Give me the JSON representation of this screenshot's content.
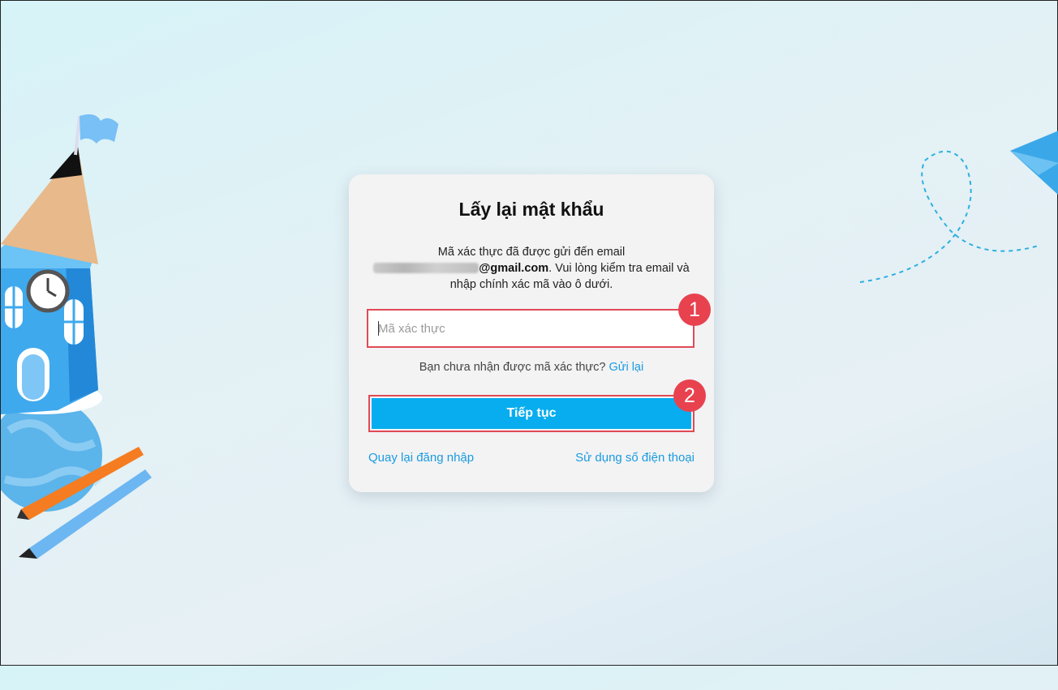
{
  "recovery": {
    "title": "Lấy lại mật khẩu",
    "desc_line1": "Mã xác thực đã được gửi đến email",
    "email_domain": "@gmail.com",
    "desc_line2": ". Vui lòng kiểm tra email và",
    "desc_line3": "nhập chính xác mã vào ô dưới.",
    "code_placeholder": "Mã xác thực",
    "resend_prompt": "Bạn chưa nhận được mã xác thực?",
    "resend_link": "Gửi lại",
    "continue_label": "Tiếp tục",
    "back_to_login": "Quay lại đăng nhập",
    "use_phone": "Sử dụng số điện thoại"
  },
  "annotations": {
    "step1": "1",
    "step2": "2"
  },
  "colors": {
    "accent": "#08adef",
    "link": "#1a9be0",
    "highlight": "#e04a55"
  }
}
